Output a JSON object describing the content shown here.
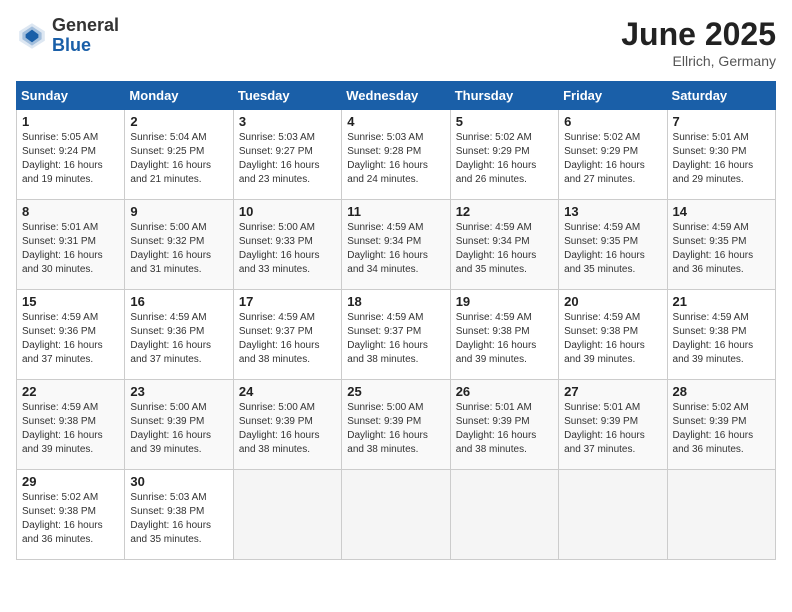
{
  "logo": {
    "general": "General",
    "blue": "Blue"
  },
  "title": "June 2025",
  "location": "Ellrich, Germany",
  "days_header": [
    "Sunday",
    "Monday",
    "Tuesday",
    "Wednesday",
    "Thursday",
    "Friday",
    "Saturday"
  ],
  "weeks": [
    [
      {
        "day": "1",
        "sunrise": "Sunrise: 5:05 AM",
        "sunset": "Sunset: 9:24 PM",
        "daylight": "Daylight: 16 hours and 19 minutes."
      },
      {
        "day": "2",
        "sunrise": "Sunrise: 5:04 AM",
        "sunset": "Sunset: 9:25 PM",
        "daylight": "Daylight: 16 hours and 21 minutes."
      },
      {
        "day": "3",
        "sunrise": "Sunrise: 5:03 AM",
        "sunset": "Sunset: 9:27 PM",
        "daylight": "Daylight: 16 hours and 23 minutes."
      },
      {
        "day": "4",
        "sunrise": "Sunrise: 5:03 AM",
        "sunset": "Sunset: 9:28 PM",
        "daylight": "Daylight: 16 hours and 24 minutes."
      },
      {
        "day": "5",
        "sunrise": "Sunrise: 5:02 AM",
        "sunset": "Sunset: 9:29 PM",
        "daylight": "Daylight: 16 hours and 26 minutes."
      },
      {
        "day": "6",
        "sunrise": "Sunrise: 5:02 AM",
        "sunset": "Sunset: 9:29 PM",
        "daylight": "Daylight: 16 hours and 27 minutes."
      },
      {
        "day": "7",
        "sunrise": "Sunrise: 5:01 AM",
        "sunset": "Sunset: 9:30 PM",
        "daylight": "Daylight: 16 hours and 29 minutes."
      }
    ],
    [
      {
        "day": "8",
        "sunrise": "Sunrise: 5:01 AM",
        "sunset": "Sunset: 9:31 PM",
        "daylight": "Daylight: 16 hours and 30 minutes."
      },
      {
        "day": "9",
        "sunrise": "Sunrise: 5:00 AM",
        "sunset": "Sunset: 9:32 PM",
        "daylight": "Daylight: 16 hours and 31 minutes."
      },
      {
        "day": "10",
        "sunrise": "Sunrise: 5:00 AM",
        "sunset": "Sunset: 9:33 PM",
        "daylight": "Daylight: 16 hours and 33 minutes."
      },
      {
        "day": "11",
        "sunrise": "Sunrise: 4:59 AM",
        "sunset": "Sunset: 9:34 PM",
        "daylight": "Daylight: 16 hours and 34 minutes."
      },
      {
        "day": "12",
        "sunrise": "Sunrise: 4:59 AM",
        "sunset": "Sunset: 9:34 PM",
        "daylight": "Daylight: 16 hours and 35 minutes."
      },
      {
        "day": "13",
        "sunrise": "Sunrise: 4:59 AM",
        "sunset": "Sunset: 9:35 PM",
        "daylight": "Daylight: 16 hours and 35 minutes."
      },
      {
        "day": "14",
        "sunrise": "Sunrise: 4:59 AM",
        "sunset": "Sunset: 9:35 PM",
        "daylight": "Daylight: 16 hours and 36 minutes."
      }
    ],
    [
      {
        "day": "15",
        "sunrise": "Sunrise: 4:59 AM",
        "sunset": "Sunset: 9:36 PM",
        "daylight": "Daylight: 16 hours and 37 minutes."
      },
      {
        "day": "16",
        "sunrise": "Sunrise: 4:59 AM",
        "sunset": "Sunset: 9:36 PM",
        "daylight": "Daylight: 16 hours and 37 minutes."
      },
      {
        "day": "17",
        "sunrise": "Sunrise: 4:59 AM",
        "sunset": "Sunset: 9:37 PM",
        "daylight": "Daylight: 16 hours and 38 minutes."
      },
      {
        "day": "18",
        "sunrise": "Sunrise: 4:59 AM",
        "sunset": "Sunset: 9:37 PM",
        "daylight": "Daylight: 16 hours and 38 minutes."
      },
      {
        "day": "19",
        "sunrise": "Sunrise: 4:59 AM",
        "sunset": "Sunset: 9:38 PM",
        "daylight": "Daylight: 16 hours and 39 minutes."
      },
      {
        "day": "20",
        "sunrise": "Sunrise: 4:59 AM",
        "sunset": "Sunset: 9:38 PM",
        "daylight": "Daylight: 16 hours and 39 minutes."
      },
      {
        "day": "21",
        "sunrise": "Sunrise: 4:59 AM",
        "sunset": "Sunset: 9:38 PM",
        "daylight": "Daylight: 16 hours and 39 minutes."
      }
    ],
    [
      {
        "day": "22",
        "sunrise": "Sunrise: 4:59 AM",
        "sunset": "Sunset: 9:38 PM",
        "daylight": "Daylight: 16 hours and 39 minutes."
      },
      {
        "day": "23",
        "sunrise": "Sunrise: 5:00 AM",
        "sunset": "Sunset: 9:39 PM",
        "daylight": "Daylight: 16 hours and 39 minutes."
      },
      {
        "day": "24",
        "sunrise": "Sunrise: 5:00 AM",
        "sunset": "Sunset: 9:39 PM",
        "daylight": "Daylight: 16 hours and 38 minutes."
      },
      {
        "day": "25",
        "sunrise": "Sunrise: 5:00 AM",
        "sunset": "Sunset: 9:39 PM",
        "daylight": "Daylight: 16 hours and 38 minutes."
      },
      {
        "day": "26",
        "sunrise": "Sunrise: 5:01 AM",
        "sunset": "Sunset: 9:39 PM",
        "daylight": "Daylight: 16 hours and 38 minutes."
      },
      {
        "day": "27",
        "sunrise": "Sunrise: 5:01 AM",
        "sunset": "Sunset: 9:39 PM",
        "daylight": "Daylight: 16 hours and 37 minutes."
      },
      {
        "day": "28",
        "sunrise": "Sunrise: 5:02 AM",
        "sunset": "Sunset: 9:39 PM",
        "daylight": "Daylight: 16 hours and 36 minutes."
      }
    ],
    [
      {
        "day": "29",
        "sunrise": "Sunrise: 5:02 AM",
        "sunset": "Sunset: 9:38 PM",
        "daylight": "Daylight: 16 hours and 36 minutes."
      },
      {
        "day": "30",
        "sunrise": "Sunrise: 5:03 AM",
        "sunset": "Sunset: 9:38 PM",
        "daylight": "Daylight: 16 hours and 35 minutes."
      },
      null,
      null,
      null,
      null,
      null
    ]
  ]
}
